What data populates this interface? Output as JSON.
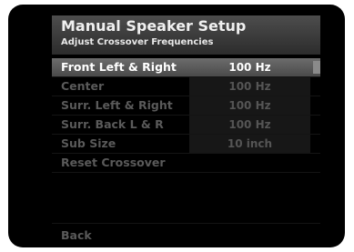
{
  "header": {
    "title": "Manual Speaker Setup",
    "subtitle": "Adjust Crossover Frequencies"
  },
  "menu": {
    "items": [
      {
        "label": "Front Left & Right",
        "value": "100 Hz",
        "selected": true
      },
      {
        "label": "Center",
        "value": "100 Hz"
      },
      {
        "label": "Surr. Left & Right",
        "value": "100 Hz"
      },
      {
        "label": "Surr. Back L & R",
        "value": "100 Hz"
      },
      {
        "label": "Sub Size",
        "value": "10 inch"
      },
      {
        "label": "Reset Crossover"
      }
    ]
  },
  "footer": {
    "back_label": "Back"
  }
}
